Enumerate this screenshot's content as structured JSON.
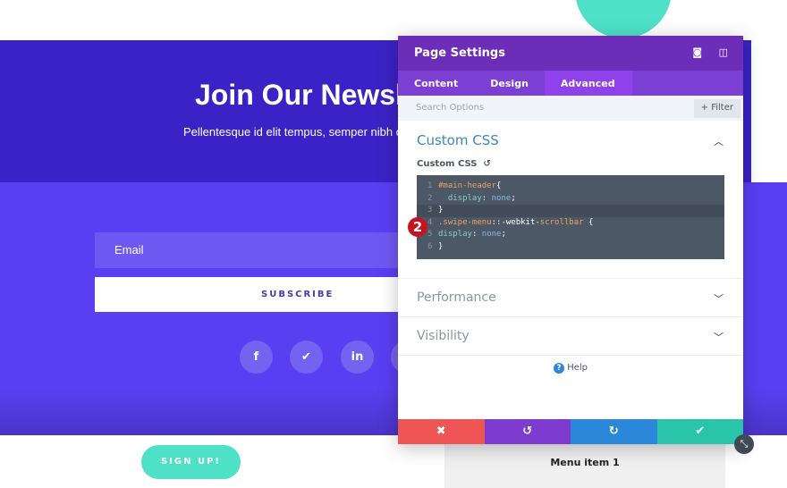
{
  "page": {
    "title": "Join Our Newsl",
    "subtitle": "Pellentesque id elit tempus, semper nibh qu",
    "email_placeholder": "Email",
    "subscribe": "SUBSCRIBE",
    "signup": "SIGN UP!",
    "menu_item": "Menu item 1",
    "social": [
      {
        "icon": "facebook-icon",
        "glyph": "f"
      },
      {
        "icon": "twitter-icon",
        "glyph": "🐦"
      },
      {
        "icon": "linkedin-icon",
        "glyph": "in"
      }
    ]
  },
  "panel": {
    "title": "Page Settings",
    "tabs": [
      "Content",
      "Design",
      "Advanced"
    ],
    "active_tab": "Advanced",
    "search_placeholder": "Search Options",
    "filter": "+ Filter",
    "custom_css_section": "Custom CSS",
    "custom_css_label": "Custom CSS",
    "code": [
      {
        "n": "1",
        "parts": [
          [
            "sel",
            "#main-header"
          ],
          [
            "",
            "{"
          ]
        ]
      },
      {
        "n": "2",
        "parts": [
          [
            "prop",
            "  display"
          ],
          [
            "",
            ": "
          ],
          [
            "val",
            "none"
          ],
          [
            "",
            ";"
          ]
        ]
      },
      {
        "n": "3",
        "parts": [
          [
            "",
            "}"
          ]
        ]
      },
      {
        "n": "4",
        "parts": [
          [
            "sel",
            ".swipe-menu"
          ],
          [
            "",
            "::-webkit-"
          ],
          [
            "sel",
            "scrollbar"
          ],
          [
            "",
            " {"
          ]
        ]
      },
      {
        "n": "5",
        "parts": [
          [
            "prop",
            "display"
          ],
          [
            "",
            ": "
          ],
          [
            "val",
            "none"
          ],
          [
            "",
            ";"
          ]
        ]
      },
      {
        "n": "6",
        "parts": [
          [
            "",
            "}"
          ]
        ]
      }
    ],
    "badge": "2",
    "performance": "Performance",
    "visibility": "Visibility",
    "help": "Help"
  },
  "colors": {
    "header": "#6c2eb9",
    "cancel": "#ef5555",
    "undo": "#7e3bd0",
    "redo": "#2b87da",
    "save": "#29c4a9"
  }
}
